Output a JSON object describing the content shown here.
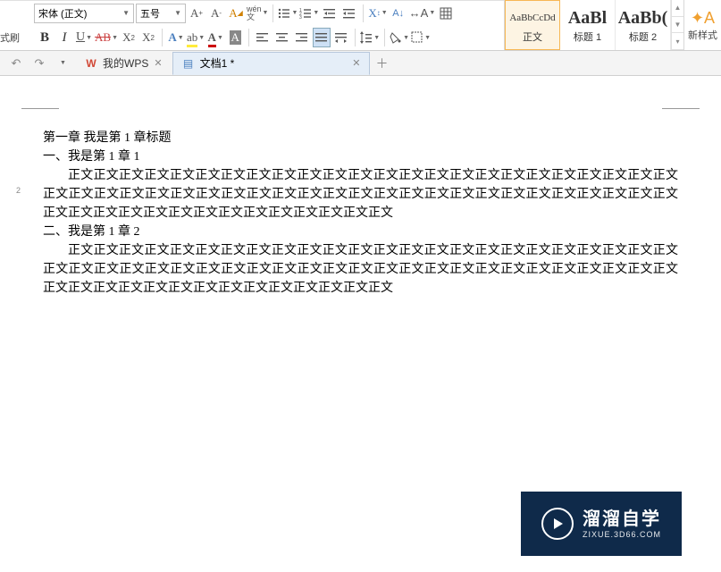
{
  "ribbon": {
    "font_name": "宋体 (正文)",
    "font_size": "五号",
    "format_brush": "式刷",
    "increase_font": "A⁺",
    "decrease_font": "A⁻",
    "wen_btn": "wén",
    "wen_sub": "文",
    "bold": "B",
    "italic": "I",
    "underline": "U",
    "strike": "AB",
    "superscript": "X²",
    "subscript": "X₂",
    "font_effect": "A",
    "shading": "A"
  },
  "styles": [
    {
      "preview": "AaBbCcDd",
      "label": "正文",
      "big": false
    },
    {
      "preview": "AaBl",
      "label": "标题 1",
      "big": true
    },
    {
      "preview": "AaBb(",
      "label": "标题 2",
      "big": true
    }
  ],
  "new_style": "新样式",
  "tabs": {
    "home": "我的WPS",
    "doc": "文档1 *"
  },
  "document": {
    "chapter_title": "第一章  我是第 1 章标题",
    "sec1_title": "一、我是第 1 章 1",
    "body1": "正文正文正文正文正文正文正文正文正文正文正文正文正文正文正文正文正文正文正文正文正文正文正文正文正文正文正文正文正文正文正文正文正文正文正文正文正文正文正文正文正文正文正文正文正文正文正文正文正文正文正文正文正文正文正文正文正文正文正文正文正文正文正文",
    "sec2_title": "二、我是第 1 章 2",
    "body2": "正文正文正文正文正文正文正文正文正文正文正文正文正文正文正文正文正文正文正文正文正文正文正文正文正文正文正文正文正文正文正文正文正文正文正文正文正文正文正文正文正文正文正文正文正文正文正文正文正文正文正文正文正文正文正文正文正文正文正文正文正文正文正文"
  },
  "watermark": {
    "cn": "溜溜自学",
    "en": "ZIXUE.3D66.COM"
  },
  "ruler_mark": "2"
}
